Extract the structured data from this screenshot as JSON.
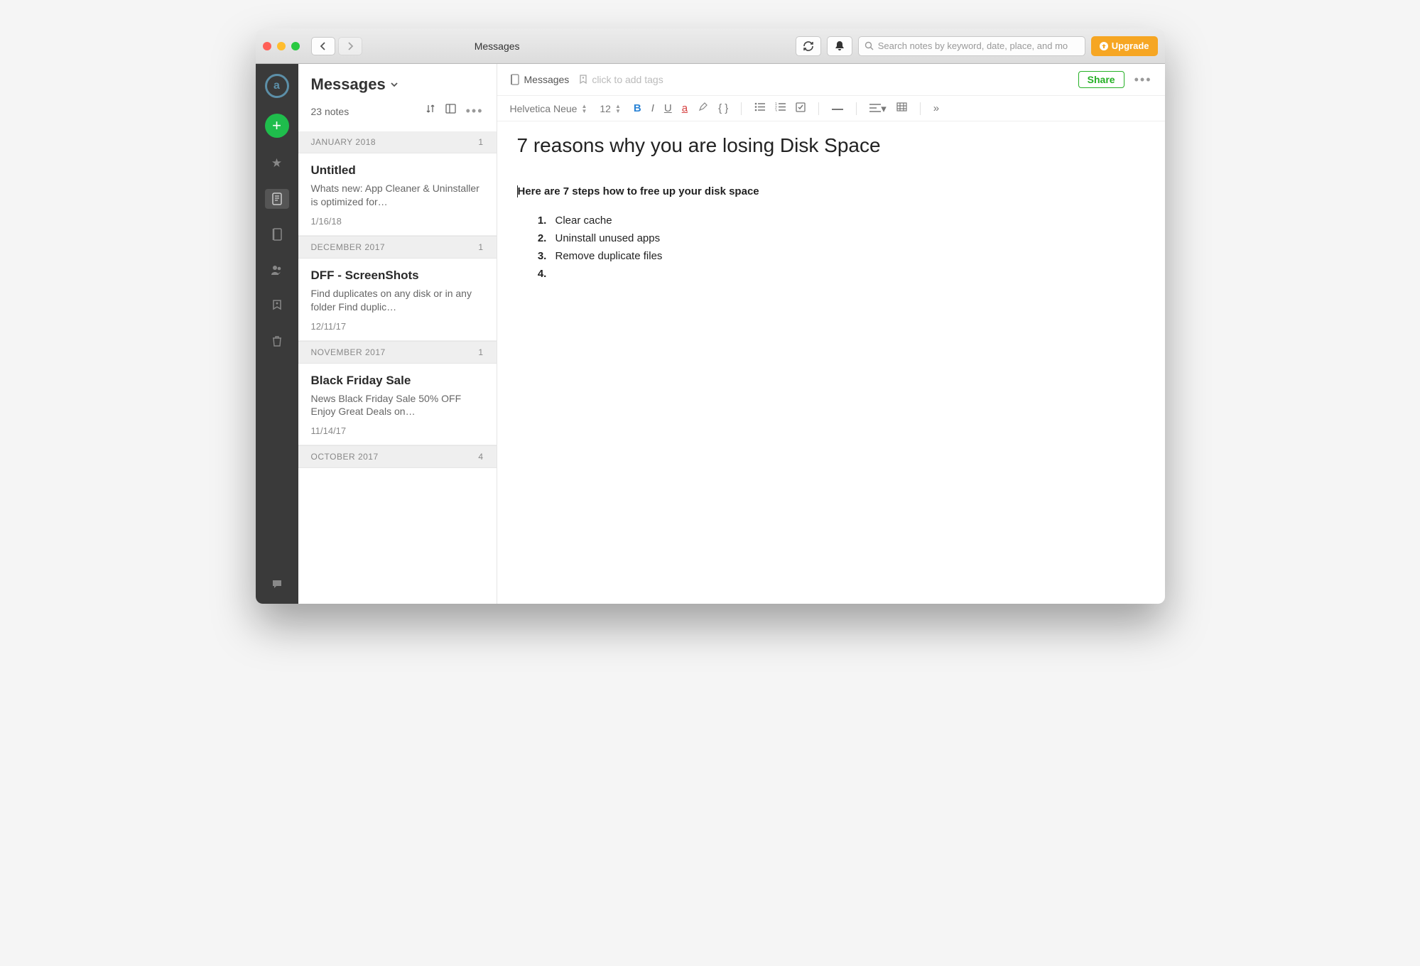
{
  "titlebar": {
    "title": "Messages",
    "search_placeholder": "Search notes by keyword, date, place, and mo",
    "upgrade_label": "Upgrade"
  },
  "iconbar": {
    "logo_letter": "a"
  },
  "notelist": {
    "title": "Messages",
    "subtitle": "23 notes",
    "groups": [
      {
        "label": "JANUARY 2018",
        "count": "1",
        "items": [
          {
            "title": "Untitled",
            "snippet": "Whats new: App Cleaner & Uninstaller is optimized for…",
            "date": "1/16/18"
          }
        ]
      },
      {
        "label": "DECEMBER 2017",
        "count": "1",
        "items": [
          {
            "title": "DFF - ScreenShots",
            "snippet": "Find duplicates on any disk or in any folder Find duplic…",
            "date": "12/11/17"
          }
        ]
      },
      {
        "label": "NOVEMBER 2017",
        "count": "1",
        "items": [
          {
            "title": "Black Friday Sale",
            "snippet": "News Black Friday Sale 50% OFF Enjoy Great Deals on…",
            "date": "11/14/17"
          }
        ]
      },
      {
        "label": "OCTOBER 2017",
        "count": "4",
        "items": []
      }
    ]
  },
  "editor": {
    "notebook": "Messages",
    "tags_placeholder": "click to add tags",
    "share_label": "Share",
    "font_name": "Helvetica Neue",
    "font_size": "12",
    "title": "7 reasons why you are losing Disk Space",
    "subhead": "Here are 7 steps how to free up your disk space",
    "list": [
      "Clear cache",
      "Uninstall unused apps",
      "Remove duplicate files",
      ""
    ]
  }
}
